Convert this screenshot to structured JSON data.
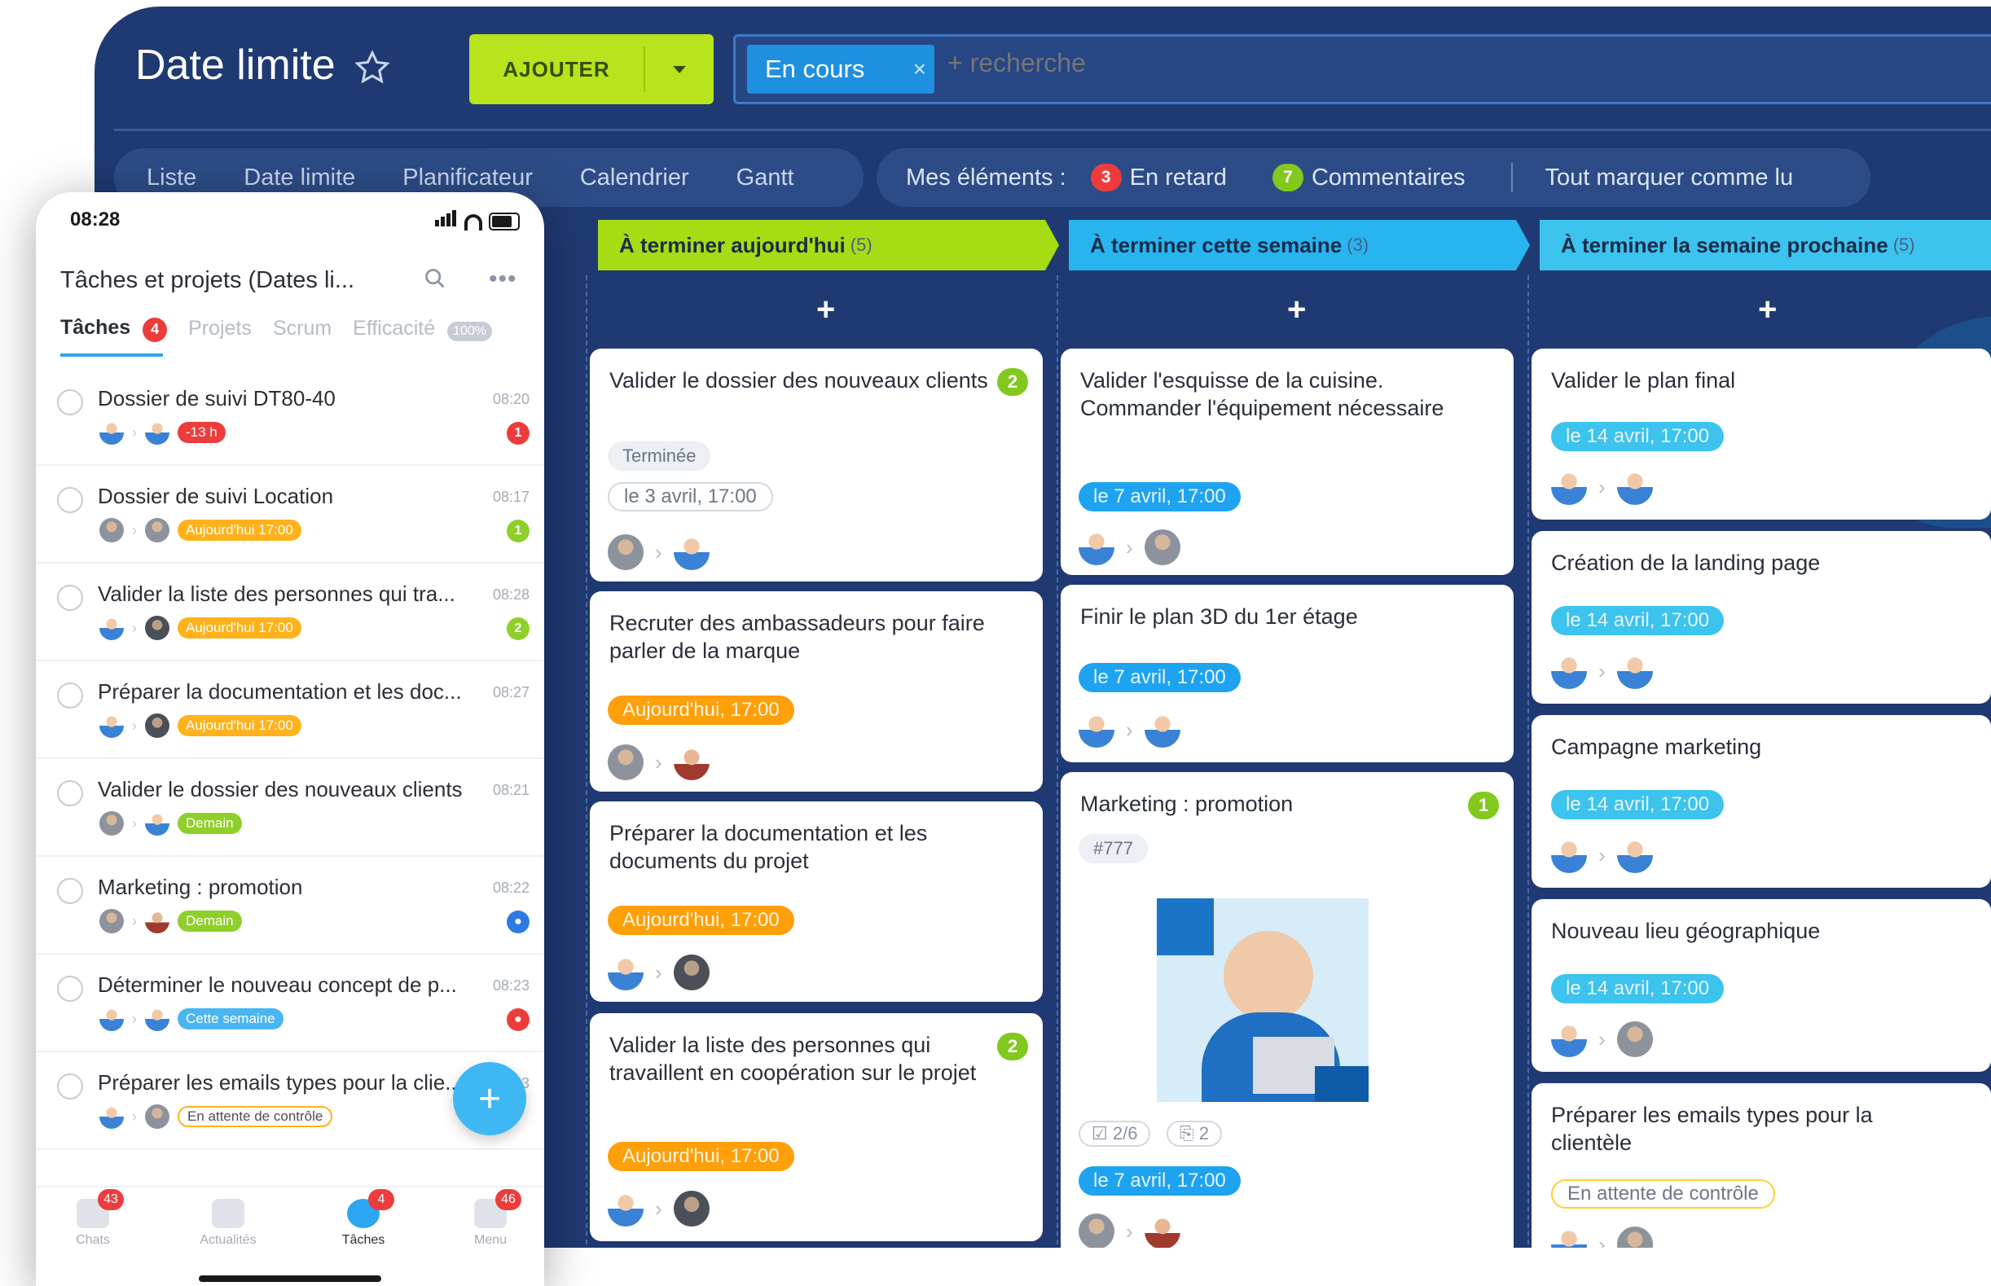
{
  "app": {
    "title": "Date limite",
    "add_button": "AJOUTER",
    "filter_chip": "En cours",
    "search_placeholder": "+ recherche"
  },
  "view_tabs": [
    "Liste",
    "Date limite",
    "Planificateur",
    "Calendrier",
    "Gantt"
  ],
  "my_items": {
    "label": "Mes éléments :",
    "late_count": "3",
    "late_label": "En retard",
    "comments_count": "7",
    "comments_label": "Commentaires",
    "mark_all": "Tout marquer comme lu"
  },
  "colors": {
    "window_bg": "#1f3a72",
    "accent_green": "#b7e41c",
    "accent_blue": "#1ea3f0",
    "accent_orange": "#ff9f0a",
    "late_red": "#ee3c3c"
  },
  "columns": [
    {
      "title": "À terminer aujourd'hui",
      "count": "(5)",
      "color": "#a6dc14",
      "cards": [
        {
          "title": "Valider le dossier des nouveaux clients",
          "badge": "2",
          "status": "Terminée",
          "date": "le 3 avril, 17:00"
        },
        {
          "title": "Recruter des ambassadeurs pour faire parler de la marque",
          "date": "Aujourd'hui, 17:00"
        },
        {
          "title": "Préparer la documentation et les documents du projet",
          "date": "Aujourd'hui, 17:00"
        },
        {
          "title": "Valider la liste des personnes qui travaillent en coopération sur le projet",
          "badge": "2",
          "date": "Aujourd'hui, 17:00"
        }
      ]
    },
    {
      "title": "À terminer cette semaine",
      "count": "(3)",
      "color": "#28b4ef",
      "cards": [
        {
          "title": "Valider l'esquisse de la cuisine. Commander l'équipement nécessaire",
          "date": "le 7 avril, 17:00"
        },
        {
          "title": "Finir le plan 3D du 1er étage",
          "date": "le 7 avril, 17:00"
        },
        {
          "title": "Marketing : promotion",
          "badge": "1",
          "tag": "#777",
          "checklist": "2/6",
          "files": "2",
          "date": "le 7 avril, 17:00"
        }
      ]
    },
    {
      "title": "À terminer la semaine prochaine",
      "count": "(5)",
      "color": "#3cc3ee",
      "cards": [
        {
          "title": "Valider le plan final",
          "date": "le 14 avril, 17:00"
        },
        {
          "title": "Création de la landing page",
          "date": "le 14 avril, 17:00"
        },
        {
          "title": "Campagne marketing",
          "date": "le 14 avril, 17:00"
        },
        {
          "title": "Nouveau lieu géographique",
          "date": "le 14 avril, 17:00"
        },
        {
          "title": "Préparer les emails types pour la clientèle",
          "status": "En attente de contrôle"
        }
      ]
    }
  ],
  "phone": {
    "time": "08:28",
    "title": "Tâches et projets (Dates li...",
    "more": "•••",
    "tabs": {
      "tasks": "Tâches",
      "tasks_count": "4",
      "projects": "Projets",
      "scrum": "Scrum",
      "efficiency": "Efficacité",
      "efficiency_pct": "100%"
    },
    "rows": [
      {
        "title": "Dossier de suivi DT80-40",
        "time": "08:20",
        "tag": "-13 h",
        "indicator": "1"
      },
      {
        "title": "Dossier de suivi Location",
        "time": "08:17",
        "tag": "Aujourd'hui 17:00",
        "indicator": "1"
      },
      {
        "title": "Valider la liste des personnes qui tra...",
        "time": "08:28",
        "tag": "Aujourd'hui 17:00",
        "indicator": "2"
      },
      {
        "title": "Préparer la documentation et les doc...",
        "time": "08:27",
        "tag": "Aujourd'hui 17:00"
      },
      {
        "title": "Valider le dossier des nouveaux clients",
        "time": "08:21",
        "tag": "Demain"
      },
      {
        "title": "Marketing : promotion",
        "time": "08:22",
        "tag": "Demain"
      },
      {
        "title": "Déterminer le nouveau concept de p...",
        "time": "08:23",
        "tag": "Cette semaine"
      },
      {
        "title": "Préparer les emails types pour la clie...",
        "time": "08:23",
        "tag": "En attente de contrôle"
      }
    ],
    "fab": "+",
    "nav": [
      {
        "label": "Chats",
        "badge": "43"
      },
      {
        "label": "Actualités"
      },
      {
        "label": "Tâches",
        "badge": "4"
      },
      {
        "label": "Menu",
        "badge": "46"
      }
    ]
  }
}
